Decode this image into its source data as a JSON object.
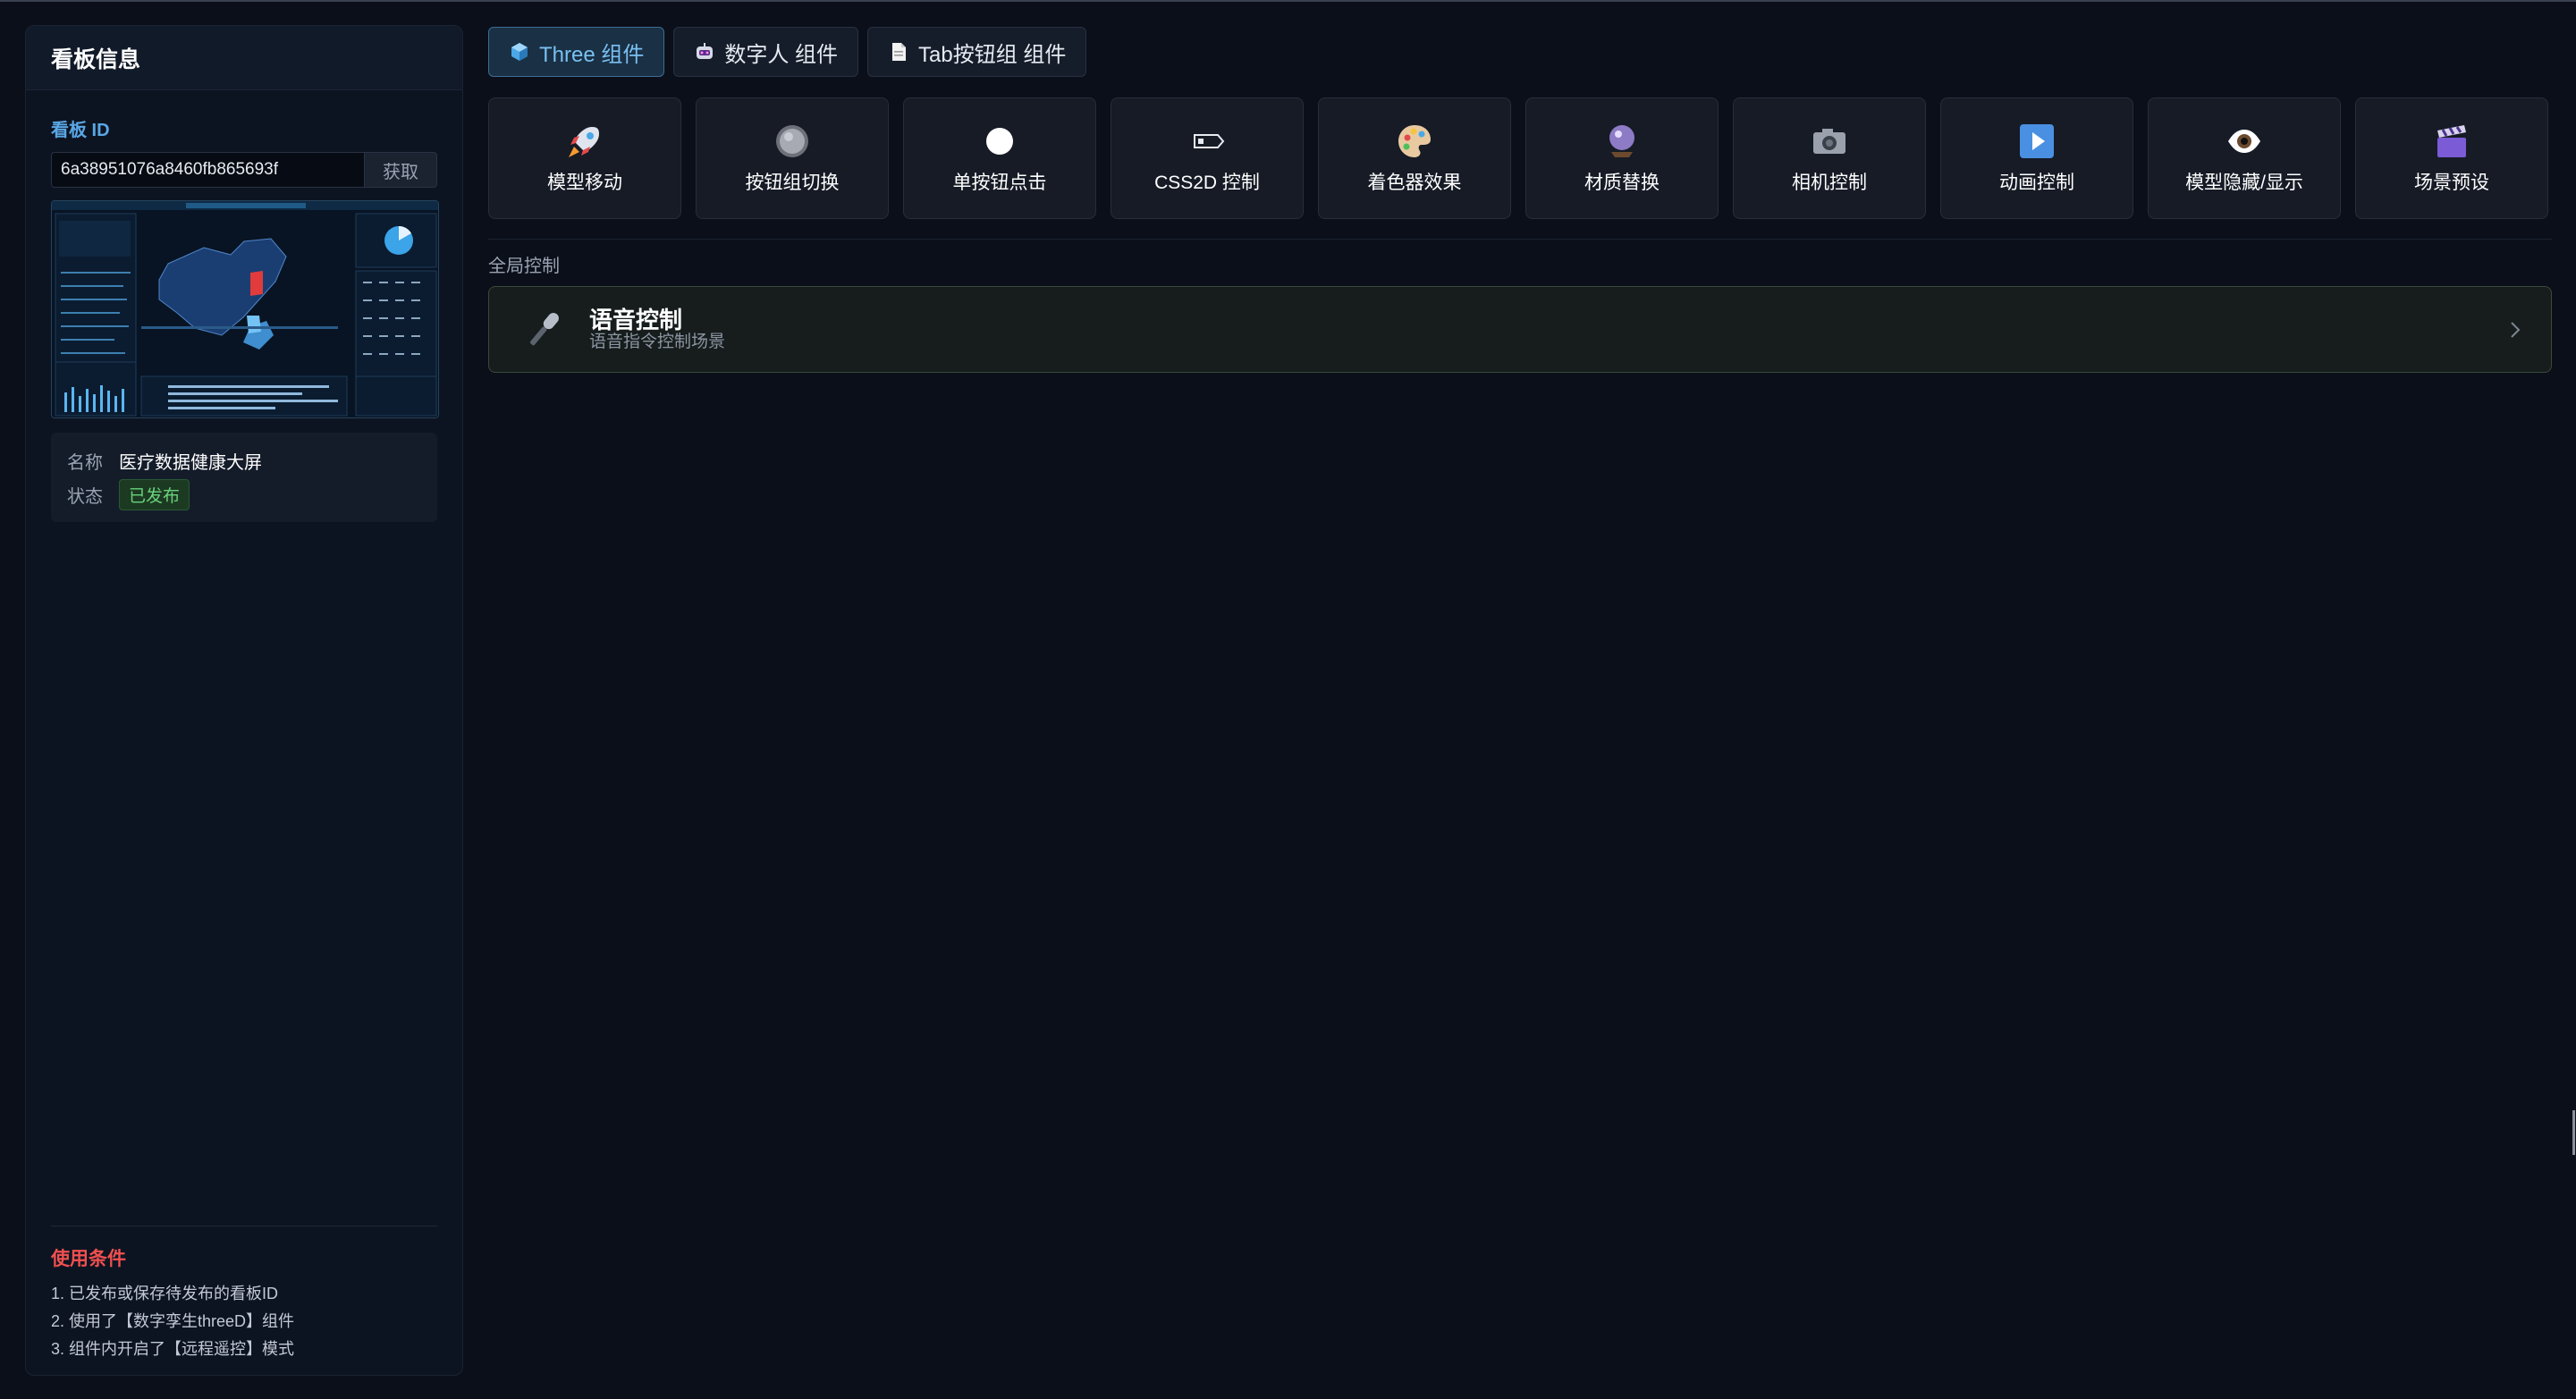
{
  "sidebar": {
    "title": "看板信息",
    "id_label": "看板 ID",
    "id_value": "6a38951076a8460fb865693f",
    "fetch_label": "获取",
    "name_key": "名称",
    "name_value": "医疗数据健康大屏",
    "status_key": "状态",
    "status_value": "已发布",
    "conditions": {
      "title": "使用条件",
      "items": [
        "1. 已发布或保存待发布的看板ID",
        "2. 使用了【数字孪生threeD】组件",
        "3. 组件内开启了【远程遥控】模式"
      ]
    }
  },
  "tabs": [
    {
      "label": "Three 组件",
      "icon": "cube-icon",
      "active": true
    },
    {
      "label": "数字人 组件",
      "icon": "robot-icon",
      "active": false
    },
    {
      "label": "Tab按钮组 组件",
      "icon": "page-icon",
      "active": false
    }
  ],
  "cards": [
    {
      "label": "模型移动",
      "icon": "rocket-icon"
    },
    {
      "label": "按钮组切换",
      "icon": "grey-circle-icon"
    },
    {
      "label": "单按钮点击",
      "icon": "white-circle-icon"
    },
    {
      "label": "CSS2D 控制",
      "icon": "tag-icon"
    },
    {
      "label": "着色器效果",
      "icon": "palette-icon"
    },
    {
      "label": "材质替换",
      "icon": "crystal-ball-icon"
    },
    {
      "label": "相机控制",
      "icon": "camera-icon"
    },
    {
      "label": "动画控制",
      "icon": "play-icon"
    },
    {
      "label": "模型隐藏/显示",
      "icon": "eye-icon"
    },
    {
      "label": "场景预设",
      "icon": "clapper-icon"
    }
  ],
  "section_label": "全局控制",
  "voice": {
    "title": "语音控制",
    "subtitle": "语音指令控制场景",
    "icon": "microphone-icon"
  },
  "colors": {
    "background": "#0b0f1a",
    "accent": "#5aa7e6",
    "danger": "#f05050",
    "success": "#6ad27c"
  }
}
